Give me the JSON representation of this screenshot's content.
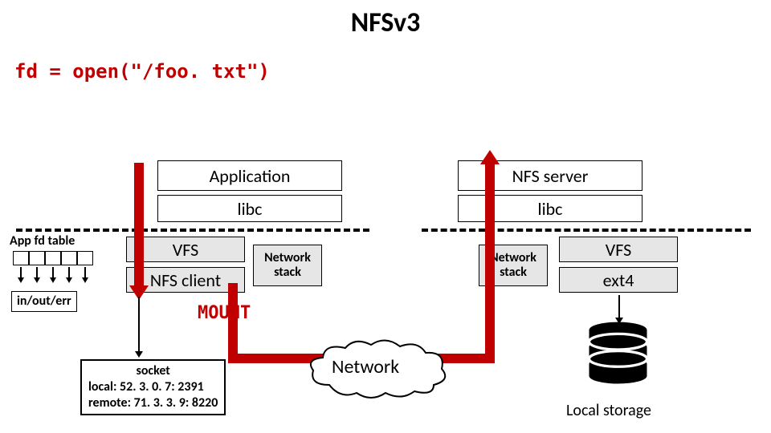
{
  "title": "NFSv3",
  "code_line": "fd = open(\"/foo. txt\")",
  "client": {
    "application": "Application",
    "libc": "libc",
    "vfs": "VFS",
    "nfs_client": "NFS client",
    "network_stack_l1": "Network",
    "network_stack_l2": "stack"
  },
  "server": {
    "nfs_server": "NFS server",
    "libc": "libc",
    "vfs": "VFS",
    "ext4": "ext4",
    "network_stack_l1": "Network",
    "network_stack_l2": "stack"
  },
  "mount_label": "MOUNT",
  "fd_table_label": "App fd table",
  "in_out_err_label": "in/out/err",
  "socket": {
    "title": "socket",
    "local": "local:   52. 3. 0. 7: 2391",
    "remote": "remote: 71. 3. 3. 9: 8220"
  },
  "network_cloud_label": "Network",
  "local_storage_label": "Local storage"
}
